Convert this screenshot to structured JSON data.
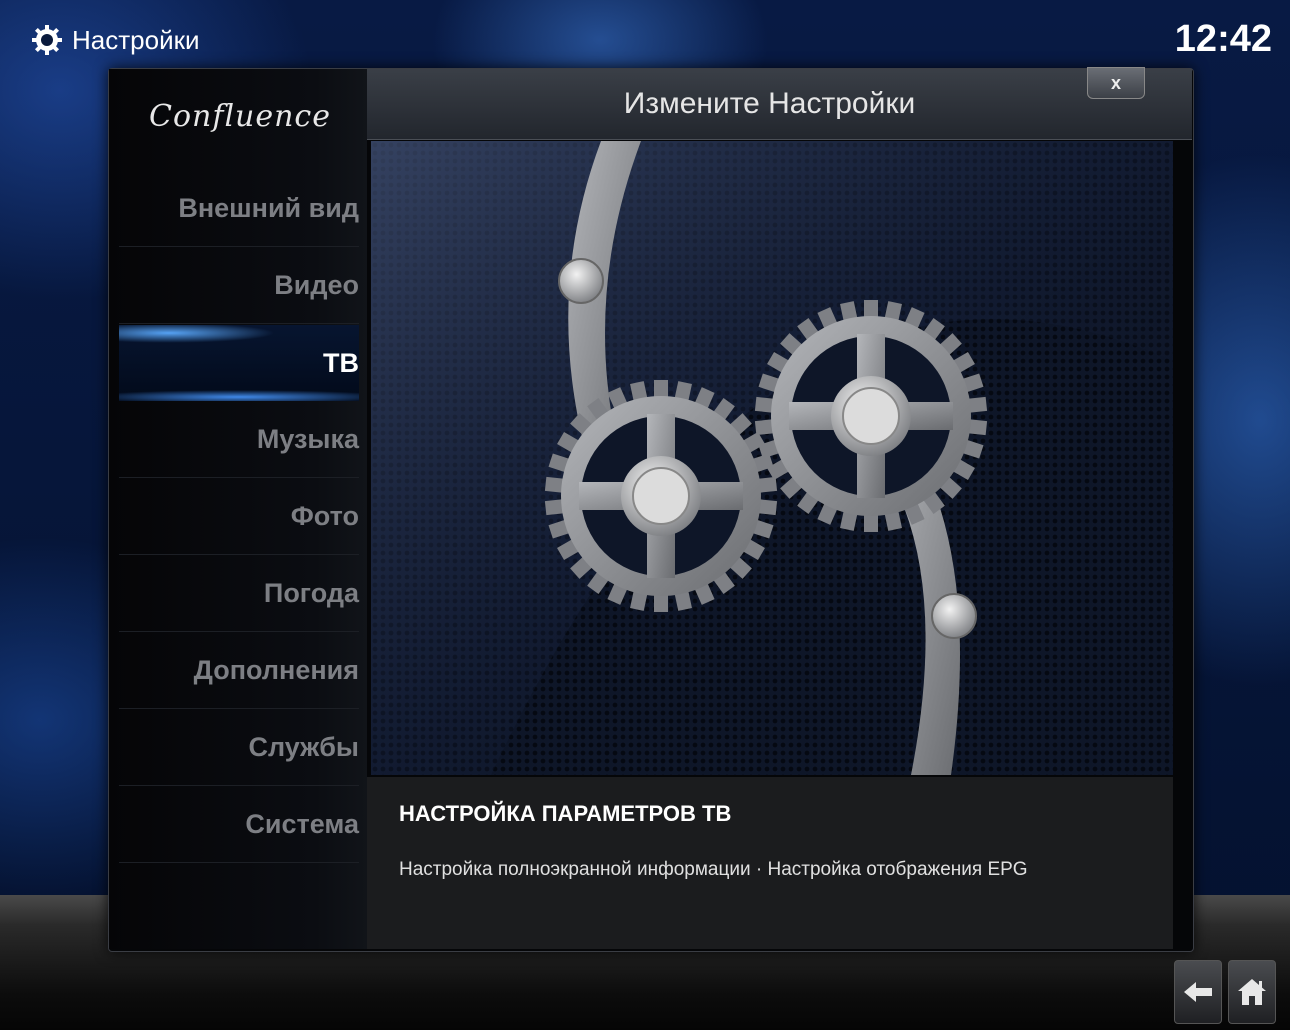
{
  "topbar": {
    "title": "Настройки",
    "clock": "12:42"
  },
  "dialog": {
    "logo_text": "Confluence",
    "header_title": "Измените Настройки",
    "close_label": "x"
  },
  "sidebar": {
    "items": [
      {
        "label": "Внешний вид",
        "active": false
      },
      {
        "label": "Видео",
        "active": false
      },
      {
        "label": "ТВ",
        "active": true
      },
      {
        "label": "Музыка",
        "active": false
      },
      {
        "label": "Фото",
        "active": false
      },
      {
        "label": "Погода",
        "active": false
      },
      {
        "label": "Дополнения",
        "active": false
      },
      {
        "label": "Службы",
        "active": false
      },
      {
        "label": "Система",
        "active": false
      }
    ]
  },
  "info": {
    "title": "НАСТРОЙКА ПАРАМЕТРОВ ТВ",
    "description": "Настройка полноэкранной информации · Настройка отображения EPG"
  },
  "icons": {
    "topbar": "gear-icon",
    "back": "back-arrow-icon",
    "home": "home-icon",
    "art": "gears-artwork"
  },
  "colors": {
    "accent_blue": "#4a9aff",
    "active_text": "#ffffff",
    "inactive_text": "#7d7f84"
  }
}
